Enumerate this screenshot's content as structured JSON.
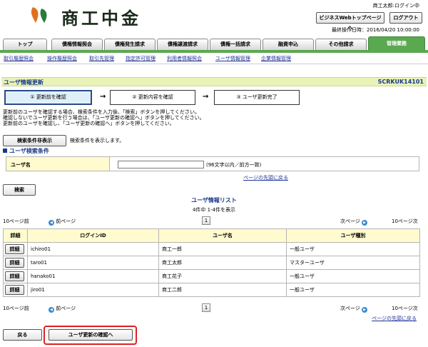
{
  "header": {
    "logo_text": "商工中金",
    "user_status": "商工太郎:ログイン中",
    "top_page_button": "ビジネスWebトップページへ",
    "logout_button": "ログアウト",
    "last_operation": "最終操作日時：2016/04/20 10:00:00"
  },
  "tabs": [
    {
      "label": "トップ",
      "active": false
    },
    {
      "label": "債権情報照会",
      "active": false
    },
    {
      "label": "債権発生請求",
      "active": false
    },
    {
      "label": "債権譲渡請求",
      "active": false
    },
    {
      "label": "債権一括請求",
      "active": false
    },
    {
      "label": "融資申込",
      "active": false
    },
    {
      "label": "その他請求",
      "active": false
    },
    {
      "label": "管理業務",
      "active": true
    }
  ],
  "subnav": [
    "取引履歴照会",
    "操作履歴照会",
    "取引先管理",
    "指定許可管理",
    "利用者情報照会",
    "ユーザ情報管理",
    "企業情報管理"
  ],
  "page": {
    "title": "ユーザ情報更新",
    "screen_code": "SCRKUK14101"
  },
  "steps": [
    "① 更新前を確認",
    "② 更新内容を確認",
    "③ ユーザ更新完了"
  ],
  "step_arrow": "→",
  "description": [
    "更新前のユーザを確認する場合、検索条件を入力後、「検索」ボタンを押してください。",
    "確認しないでユーザ更新を行う場合は、「ユーザ更新の確認へ」ボタンを押してください。",
    "更新前のユーザを確認し、「ユーザ更新の確認へ」ボタンを押してください。"
  ],
  "search": {
    "toggle_button": "検索条件非表示",
    "toggle_note": "検索条件を表示します。",
    "section_title": "ユーザ検索条件",
    "field_label": "ユーザ名",
    "field_value": "",
    "field_note": "(96文字以内／前方一致)",
    "to_top_link": "ページの先頭に戻る",
    "search_button": "検索"
  },
  "list": {
    "title": "ユーザ情報リスト",
    "count": "4件中 1-4件を表示",
    "prev10": "10ページ前",
    "prev": "前ページ",
    "page": "1",
    "next": "次ページ",
    "next10": "10ページ次",
    "columns": [
      "詳細",
      "ログインID",
      "ユーザ名",
      "ユーザ種別"
    ],
    "detail_button": "詳細",
    "rows": [
      {
        "login_id": "ichiro01",
        "name": "商工一郎",
        "type": "一般ユーザ"
      },
      {
        "login_id": "taro01",
        "name": "商工太郎",
        "type": "マスターユーザ"
      },
      {
        "login_id": "hanako01",
        "name": "商工花子",
        "type": "一般ユーザ"
      },
      {
        "login_id": "jiro01",
        "name": "商工二郎",
        "type": "一般ユーザ"
      }
    ],
    "to_top_link": "ページの先頭に戻る"
  },
  "footer": {
    "back_button": "戻る",
    "confirm_button": "ユーザ更新の確認へ"
  },
  "colors": {
    "active_tab": "#5aa850",
    "title_bar": "#e9f3b8",
    "header_cell": "#fffbcf",
    "highlight_border": "#e02020"
  }
}
